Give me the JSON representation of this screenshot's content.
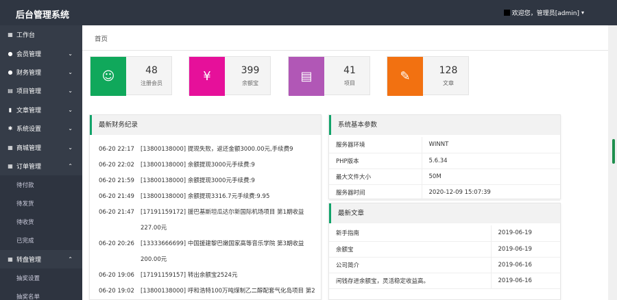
{
  "header": {
    "brand": "后台管理系统",
    "user_text": "欢迎您，管理员[admin]"
  },
  "sidebar": {
    "items": [
      {
        "icon": "dashboard-icon",
        "glyph": "▦",
        "label": "工作台",
        "chevron": ""
      },
      {
        "icon": "member-icon",
        "glyph": "●",
        "label": "会员管理",
        "chevron": "⌄"
      },
      {
        "icon": "finance-icon",
        "glyph": "●",
        "label": "财务管理",
        "chevron": "⌄"
      },
      {
        "icon": "project-icon",
        "glyph": "▤",
        "label": "项目管理",
        "chevron": "⌄"
      },
      {
        "icon": "article-icon",
        "glyph": "▮",
        "label": "文章管理",
        "chevron": "⌄"
      },
      {
        "icon": "settings-icon",
        "glyph": "✱",
        "label": "系统设置",
        "chevron": "⌄"
      },
      {
        "icon": "shop-icon",
        "glyph": "▦",
        "label": "商城管理",
        "chevron": "⌄"
      },
      {
        "icon": "order-icon",
        "glyph": "▦",
        "label": "订单管理",
        "chevron": "⌃"
      }
    ],
    "order_sub": [
      "待付款",
      "待发货",
      "待收货",
      "已完成"
    ],
    "wheel": {
      "icon": "wheel-icon",
      "glyph": "▦",
      "label": "转盘管理",
      "chevron": "⌃"
    },
    "wheel_sub": [
      "抽奖设置",
      "抽奖名单"
    ]
  },
  "breadcrumb": "首页",
  "stats": [
    {
      "value": "48",
      "label": "注册会员",
      "color": "#10a85b",
      "icon": "user-icon"
    },
    {
      "value": "399",
      "label": "余额宝",
      "color": "#e6109a",
      "icon": "wallet-icon"
    },
    {
      "value": "41",
      "label": "项目",
      "color": "#b157b6",
      "icon": "project-icon"
    },
    {
      "value": "128",
      "label": "文章",
      "color": "#f27111",
      "icon": "article-icon"
    }
  ],
  "finance": {
    "title": "最新财务纪录",
    "rows": [
      {
        "time": "06-20 22:17",
        "desc": "[13800138000] 提现失败，返还金额3000.00元,手续费9"
      },
      {
        "time": "06-20 22:02",
        "desc": "[13800138000] 余额提现3000元手续费:9"
      },
      {
        "time": "06-20 21:59",
        "desc": "[13800138000] 余额提现3000元手续费:9"
      },
      {
        "time": "06-20 21:49",
        "desc": "[13800138000] 余额提现3316.7元手续费:9.95"
      },
      {
        "time": "06-20 21:47",
        "desc": "[17191159172] 援巴基斯坦瓜达尔新国际机场项目 第1期收益227.00元"
      },
      {
        "time": "06-20 20:26",
        "desc": "[13333666699] 中国援建黎巴嫩国家高等音乐学院 第3期收益200.00元"
      },
      {
        "time": "06-20 19:06",
        "desc": "[17191159157] 转出余额宝2524元"
      },
      {
        "time": "06-20 19:02",
        "desc": "[13800138000] 呼和浩特100万吨煤制乙二醇配套气化岛项目 第2"
      }
    ]
  },
  "system": {
    "title": "系统基本参数",
    "rows": [
      {
        "k": "服务器环境",
        "v": "WINNT"
      },
      {
        "k": "PHP版本",
        "v": "5.6.34"
      },
      {
        "k": "最大文件大小",
        "v": "50M"
      },
      {
        "k": "服务器时间",
        "v": "2020-12-09 15:07:39"
      }
    ]
  },
  "articles": {
    "title": "最新文章",
    "rows": [
      {
        "k": "新手指南",
        "v": "2019-06-19"
      },
      {
        "k": "余额宝",
        "v": "2019-06-19"
      },
      {
        "k": "公司简介",
        "v": "2019-06-16"
      },
      {
        "k": "闲钱存进余额宝，灵活稳定收益高。",
        "v": "2019-06-16"
      }
    ]
  }
}
